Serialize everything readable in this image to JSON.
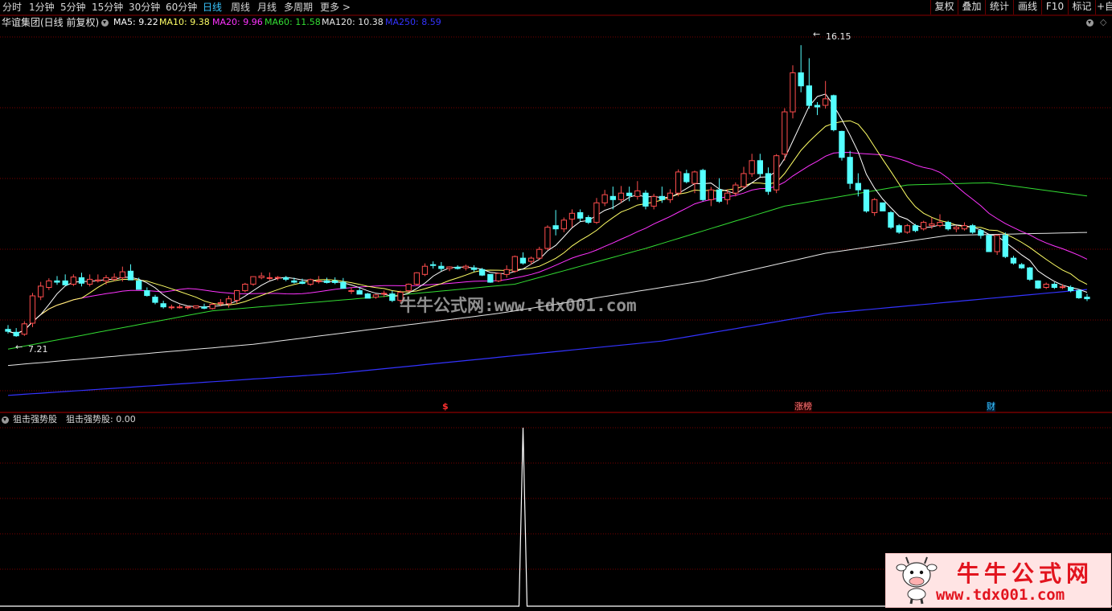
{
  "toolbar": {
    "periods": [
      "分时",
      "1分钟",
      "5分钟",
      "15分钟",
      "30分钟",
      "60分钟",
      "日线",
      "周线",
      "月线",
      "多周期",
      "更多 >"
    ],
    "active_period": "日线",
    "right_buttons": [
      "复权",
      "叠加",
      "统计",
      "画线",
      "F10",
      "标记",
      "+自"
    ]
  },
  "main_chart": {
    "title": "华谊集团(日线 前复权)",
    "ma": [
      {
        "label": "MA5: 9.22",
        "color": "#ffffff"
      },
      {
        "label": "MA10: 9.38",
        "color": "#ffff66"
      },
      {
        "label": "MA20: 9.96",
        "color": "#ff33ff"
      },
      {
        "label": "MA60: 11.58",
        "color": "#33dd33"
      },
      {
        "label": "MA120: 10.38",
        "color": "#e8e8e8"
      },
      {
        "label": "MA250: 8.59",
        "color": "#3333ff"
      }
    ],
    "high_label": "16.15",
    "low_label": "7.21",
    "markers": [
      {
        "text": "$",
        "color": "#ff3030"
      },
      {
        "text": "涨榜",
        "color": "#ff7a7a"
      },
      {
        "text": "财",
        "color": "#39c5ff"
      }
    ]
  },
  "sub_chart": {
    "title": "狙击强势股",
    "value_label": "狙击强势股: 0.00"
  },
  "watermark": {
    "center_text": "牛牛公式网:www.tdx001.com",
    "logo_title": "牛牛公式网",
    "logo_url": "www.tdx001.com"
  },
  "colors": {
    "up": "#ff4d4d",
    "down": "#54ffff",
    "grid": "#7a0000",
    "signal": "#ffffff"
  },
  "chart_data": {
    "type": "candlestick",
    "price_range": [
      5.3,
      16.6
    ],
    "candles_ohlc": [
      [
        7.41,
        7.54,
        7.28,
        7.35
      ],
      [
        7.32,
        7.45,
        7.18,
        7.21
      ],
      [
        7.26,
        7.66,
        7.21,
        7.58
      ],
      [
        7.6,
        8.53,
        7.48,
        8.44
      ],
      [
        8.41,
        8.87,
        8.31,
        8.74
      ],
      [
        8.7,
        8.98,
        8.62,
        8.9
      ],
      [
        8.9,
        9.05,
        8.78,
        8.86
      ],
      [
        8.9,
        9.1,
        8.77,
        8.78
      ],
      [
        8.8,
        9.1,
        8.74,
        9.02
      ],
      [
        9.0,
        9.15,
        8.73,
        8.83
      ],
      [
        8.8,
        9.1,
        8.73,
        8.95
      ],
      [
        8.9,
        9.1,
        8.85,
        8.93
      ],
      [
        8.9,
        9.08,
        8.79,
        9.0
      ],
      [
        8.95,
        9.13,
        8.9,
        9.01
      ],
      [
        9.0,
        9.34,
        8.88,
        9.18
      ],
      [
        9.2,
        9.41,
        9.05,
        8.93
      ],
      [
        8.9,
        9.0,
        8.65,
        8.64
      ],
      [
        8.6,
        8.7,
        8.42,
        8.45
      ],
      [
        8.4,
        8.47,
        8.18,
        8.24
      ],
      [
        8.2,
        8.29,
        8.05,
        8.1
      ],
      [
        8.1,
        8.17,
        8.02,
        8.1
      ],
      [
        8.1,
        8.17,
        8.05,
        8.1
      ],
      [
        8.08,
        8.13,
        8.02,
        8.1
      ],
      [
        8.07,
        8.14,
        8.04,
        8.13
      ],
      [
        8.1,
        8.2,
        8.03,
        8.06
      ],
      [
        8.05,
        8.23,
        8.02,
        8.18
      ],
      [
        8.2,
        8.34,
        8.12,
        8.23
      ],
      [
        8.2,
        8.44,
        8.08,
        8.35
      ],
      [
        8.3,
        8.62,
        8.2,
        8.6
      ],
      [
        8.6,
        8.84,
        8.55,
        8.8
      ],
      [
        8.8,
        9.04,
        8.75,
        9.03
      ],
      [
        9.0,
        9.16,
        8.95,
        9.05
      ],
      [
        9.0,
        9.16,
        8.92,
        9.0
      ],
      [
        9.0,
        9.05,
        8.92,
        9.01
      ],
      [
        9.0,
        9.05,
        8.89,
        8.95
      ],
      [
        8.9,
        9.0,
        8.82,
        8.86
      ],
      [
        8.87,
        8.97,
        8.8,
        8.82
      ],
      [
        8.8,
        8.97,
        8.75,
        8.94
      ],
      [
        8.9,
        9.05,
        8.82,
        8.9
      ],
      [
        8.9,
        9.0,
        8.82,
        8.85
      ],
      [
        8.9,
        9.01,
        8.8,
        8.85
      ],
      [
        8.86,
        8.99,
        8.74,
        8.67
      ],
      [
        8.6,
        8.7,
        8.5,
        8.6
      ],
      [
        8.6,
        8.7,
        8.49,
        8.49
      ],
      [
        8.5,
        8.53,
        8.37,
        8.37
      ],
      [
        8.4,
        8.5,
        8.35,
        8.47
      ],
      [
        8.5,
        8.6,
        8.4,
        8.52
      ],
      [
        8.5,
        8.6,
        8.25,
        8.3
      ],
      [
        8.3,
        8.6,
        8.23,
        8.55
      ],
      [
        8.6,
        8.82,
        8.55,
        8.8
      ],
      [
        8.8,
        9.17,
        8.75,
        9.15
      ],
      [
        9.1,
        9.44,
        9.05,
        9.35
      ],
      [
        9.4,
        9.5,
        9.28,
        9.38
      ],
      [
        9.35,
        9.48,
        9.2,
        9.28
      ],
      [
        9.28,
        9.35,
        9.2,
        9.33
      ],
      [
        9.32,
        9.38,
        9.25,
        9.28
      ],
      [
        9.3,
        9.4,
        9.22,
        9.35
      ],
      [
        9.3,
        9.38,
        9.18,
        9.25
      ],
      [
        9.25,
        9.3,
        9.05,
        9.08
      ],
      [
        9.1,
        9.1,
        8.84,
        8.86
      ],
      [
        8.9,
        9.15,
        8.86,
        9.13
      ],
      [
        9.1,
        9.38,
        9.0,
        9.25
      ],
      [
        9.2,
        9.68,
        9.15,
        9.65
      ],
      [
        9.6,
        9.78,
        9.4,
        9.45
      ],
      [
        9.5,
        9.65,
        9.4,
        9.6
      ],
      [
        9.6,
        9.95,
        9.55,
        9.87
      ],
      [
        9.9,
        10.61,
        9.85,
        10.55
      ],
      [
        10.6,
        11.08,
        10.3,
        10.5
      ],
      [
        10.5,
        10.85,
        10.4,
        10.77
      ],
      [
        10.8,
        11.1,
        10.55,
        10.98
      ],
      [
        11.0,
        11.1,
        10.73,
        10.83
      ],
      [
        10.85,
        10.92,
        10.65,
        10.7
      ],
      [
        10.7,
        11.45,
        10.65,
        11.3
      ],
      [
        11.3,
        11.7,
        11.2,
        11.55
      ],
      [
        11.5,
        11.8,
        11.1,
        11.4
      ],
      [
        11.4,
        11.82,
        11.3,
        11.6
      ],
      [
        11.6,
        11.8,
        11.35,
        11.52
      ],
      [
        11.5,
        11.97,
        11.4,
        11.67
      ],
      [
        11.6,
        11.69,
        11.1,
        11.2
      ],
      [
        11.2,
        11.58,
        11.1,
        11.5
      ],
      [
        11.5,
        11.8,
        11.3,
        11.4
      ],
      [
        11.4,
        11.72,
        11.3,
        11.6
      ],
      [
        11.6,
        12.33,
        11.5,
        12.25
      ],
      [
        12.2,
        12.32,
        11.9,
        11.95
      ],
      [
        11.9,
        12.29,
        11.6,
        12.25
      ],
      [
        12.3,
        12.35,
        11.35,
        11.4
      ],
      [
        11.4,
        11.79,
        11.2,
        11.7
      ],
      [
        11.7,
        12.06,
        11.3,
        11.35
      ],
      [
        11.4,
        11.72,
        11.25,
        11.6
      ],
      [
        11.6,
        11.93,
        11.5,
        11.85
      ],
      [
        11.8,
        12.41,
        11.75,
        12.2
      ],
      [
        12.2,
        12.81,
        12.1,
        12.6
      ],
      [
        12.6,
        12.81,
        12.1,
        12.2
      ],
      [
        12.2,
        12.39,
        11.55,
        11.65
      ],
      [
        11.7,
        12.8,
        11.6,
        12.75
      ],
      [
        12.8,
        14.21,
        12.6,
        14.1
      ],
      [
        14.1,
        15.53,
        13.9,
        15.3
      ],
      [
        15.3,
        16.15,
        14.7,
        14.9
      ],
      [
        14.9,
        15.75,
        14.2,
        14.3
      ],
      [
        14.3,
        14.4,
        14.0,
        14.25
      ],
      [
        14.3,
        15.05,
        14.2,
        14.5
      ],
      [
        14.6,
        14.63,
        13.5,
        13.55
      ],
      [
        13.5,
        13.52,
        12.6,
        12.7
      ],
      [
        12.7,
        12.9,
        11.73,
        11.9
      ],
      [
        11.9,
        12.21,
        11.5,
        11.7
      ],
      [
        11.7,
        11.7,
        11.0,
        11.05
      ],
      [
        11.0,
        11.45,
        10.9,
        11.4
      ],
      [
        11.3,
        11.31,
        11.05,
        11.05
      ],
      [
        11.0,
        11.05,
        10.5,
        10.55
      ],
      [
        10.6,
        10.65,
        10.35,
        10.4
      ],
      [
        10.4,
        10.65,
        10.35,
        10.6
      ],
      [
        10.6,
        10.65,
        10.4,
        10.45
      ],
      [
        10.5,
        10.75,
        10.45,
        10.7
      ],
      [
        10.6,
        10.85,
        10.5,
        10.65
      ],
      [
        10.6,
        10.95,
        10.55,
        10.7
      ],
      [
        10.7,
        10.75,
        10.45,
        10.5
      ],
      [
        10.5,
        10.6,
        10.4,
        10.55
      ],
      [
        10.5,
        10.7,
        10.45,
        10.6
      ],
      [
        10.6,
        10.65,
        10.35,
        10.4
      ],
      [
        10.45,
        10.5,
        10.2,
        10.3
      ],
      [
        10.3,
        10.35,
        9.8,
        9.8
      ],
      [
        9.8,
        10.33,
        9.7,
        10.3
      ],
      [
        10.3,
        10.39,
        9.6,
        9.65
      ],
      [
        9.6,
        9.67,
        9.4,
        9.45
      ],
      [
        9.4,
        9.45,
        9.27,
        9.3
      ],
      [
        9.3,
        9.33,
        8.9,
        8.95
      ],
      [
        8.9,
        8.92,
        8.65,
        8.68
      ],
      [
        8.7,
        8.85,
        8.65,
        8.8
      ],
      [
        8.8,
        8.86,
        8.65,
        8.7
      ],
      [
        8.7,
        8.8,
        8.65,
        8.72
      ],
      [
        8.7,
        8.76,
        8.55,
        8.6
      ],
      [
        8.6,
        8.65,
        8.35,
        8.38
      ],
      [
        8.4,
        8.5,
        8.28,
        8.35
      ]
    ],
    "signal_peak_index": 63,
    "signal_peak_value": 1,
    "indicator_value": 0.0
  }
}
